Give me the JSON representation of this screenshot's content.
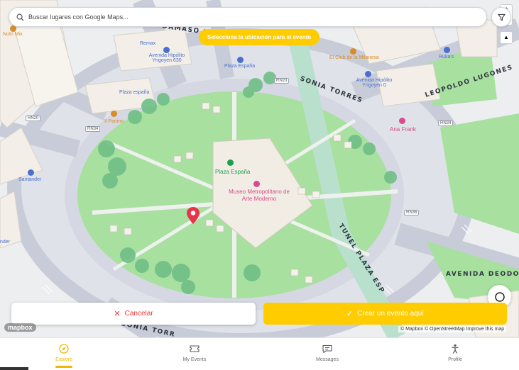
{
  "search": {
    "placeholder": "Buscar lugares con Google Maps..."
  },
  "banner": {
    "text": "Selecciona la ubicación para el evento"
  },
  "map": {
    "labels": {
      "damaso_larranaga": "DÁMASO LAR",
      "plaza_espana_street": "Plaza España",
      "sonia_torres": "SONIA TORRES",
      "leopoldo_lugones": "LEOPOLDO LUGONES",
      "tunel_plaza_espana": "TUNEL PLAZA ESP",
      "avenida_deodoro": "AVENIDA DEODO",
      "sonia_torres_bottom": "SONIA TORR",
      "plaza_espana_park": "Plaza España",
      "museo": "Museo Metropolitano de Arte Moderno",
      "remax": "Remax",
      "av_hipolito_630": "Avenida Hipólito Yrigoyen 630",
      "av_hipolito_0": "Avenida Hipólito Yrigoyen 0",
      "el_club_milanesa": "El Club de la Milanesa",
      "rukas": "Ruka's",
      "plaza_espana_left": "Plaza españa",
      "ana_frank": "Ana Frank",
      "santander": "Santander",
      "nutri_mix": "Nutri Mix",
      "il_panino": "Il Panino",
      "rn20_a": "RN20",
      "rn20_b": "RN20",
      "rn34_a": "RN34",
      "rn34_b": "RN34",
      "rn36": "RN36",
      "sander_left": "nder"
    }
  },
  "actions": {
    "cancel_label": "Cancelar",
    "create_label": "Crear un evento aquí"
  },
  "mapbox": {
    "logo": "mapbox",
    "attribution": "© Mapbox © OpenStreetMap  Improve this map"
  },
  "nav": {
    "items": [
      {
        "label": "Explore",
        "icon": "compass-icon",
        "active": true
      },
      {
        "label": "My Events",
        "icon": "ticket-icon",
        "active": false
      },
      {
        "label": "Messages",
        "icon": "message-icon",
        "active": false
      },
      {
        "label": "Profile",
        "icon": "person-icon",
        "active": false
      }
    ]
  },
  "colors": {
    "accent": "#ffcc00",
    "cancel": "#e53935",
    "pin": "#e8344a",
    "park": "#a8e0a0"
  }
}
